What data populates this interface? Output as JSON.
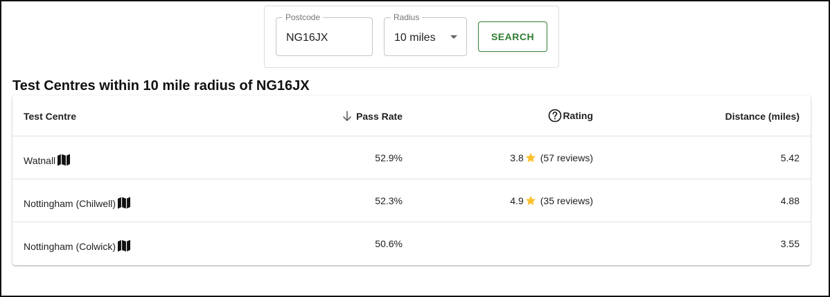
{
  "search": {
    "postcode_label": "Postcode",
    "postcode_value": "NG16JX",
    "radius_label": "Radius",
    "radius_value": "10 miles",
    "search_label": "SEARCH"
  },
  "results": {
    "title": "Test Centres within 10 mile radius of NG16JX",
    "columns": {
      "centre": "Test Centre",
      "pass_rate": "Pass Rate",
      "rating": "Rating",
      "distance": "Distance (miles)"
    },
    "rows": [
      {
        "name": "Watnall",
        "pass_rate": "52.9%",
        "rating": "3.8",
        "reviews": "(57 reviews)",
        "distance": "5.42"
      },
      {
        "name": "Nottingham (Chilwell)",
        "pass_rate": "52.3%",
        "rating": "4.9",
        "reviews": "(35 reviews)",
        "distance": "4.88"
      },
      {
        "name": "Nottingham (Colwick)",
        "pass_rate": "50.6%",
        "rating": "",
        "reviews": "",
        "distance": "3.55"
      }
    ]
  },
  "icons": {
    "sort": "arrow-down-icon",
    "help": "help-circle-icon",
    "map": "map-icon",
    "star": "star-icon",
    "dropdown": "chevron-down-icon"
  },
  "colors": {
    "accent_green": "#2e7d32",
    "star": "#fbc02d"
  }
}
